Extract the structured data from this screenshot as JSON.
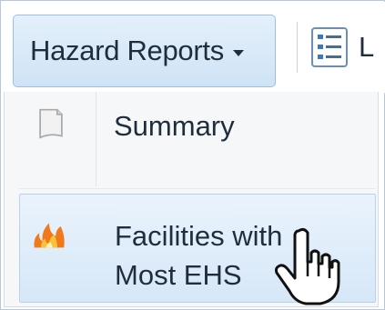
{
  "toolbar": {
    "hazard_reports_label": "Hazard Reports",
    "next_button_partial_label": "L"
  },
  "menu": {
    "items": [
      {
        "label": "Summary",
        "icon": "document-icon"
      },
      {
        "label_line1": "Facilities with",
        "label_line2": "Most EHS",
        "icon": "fire-icon",
        "highlighted": true
      }
    ]
  },
  "colors": {
    "button_bg": "#d8e8f7",
    "highlight_bg": "#dfeefb",
    "text": "#1f2d3d",
    "fire_orange": "#f07a1a"
  }
}
